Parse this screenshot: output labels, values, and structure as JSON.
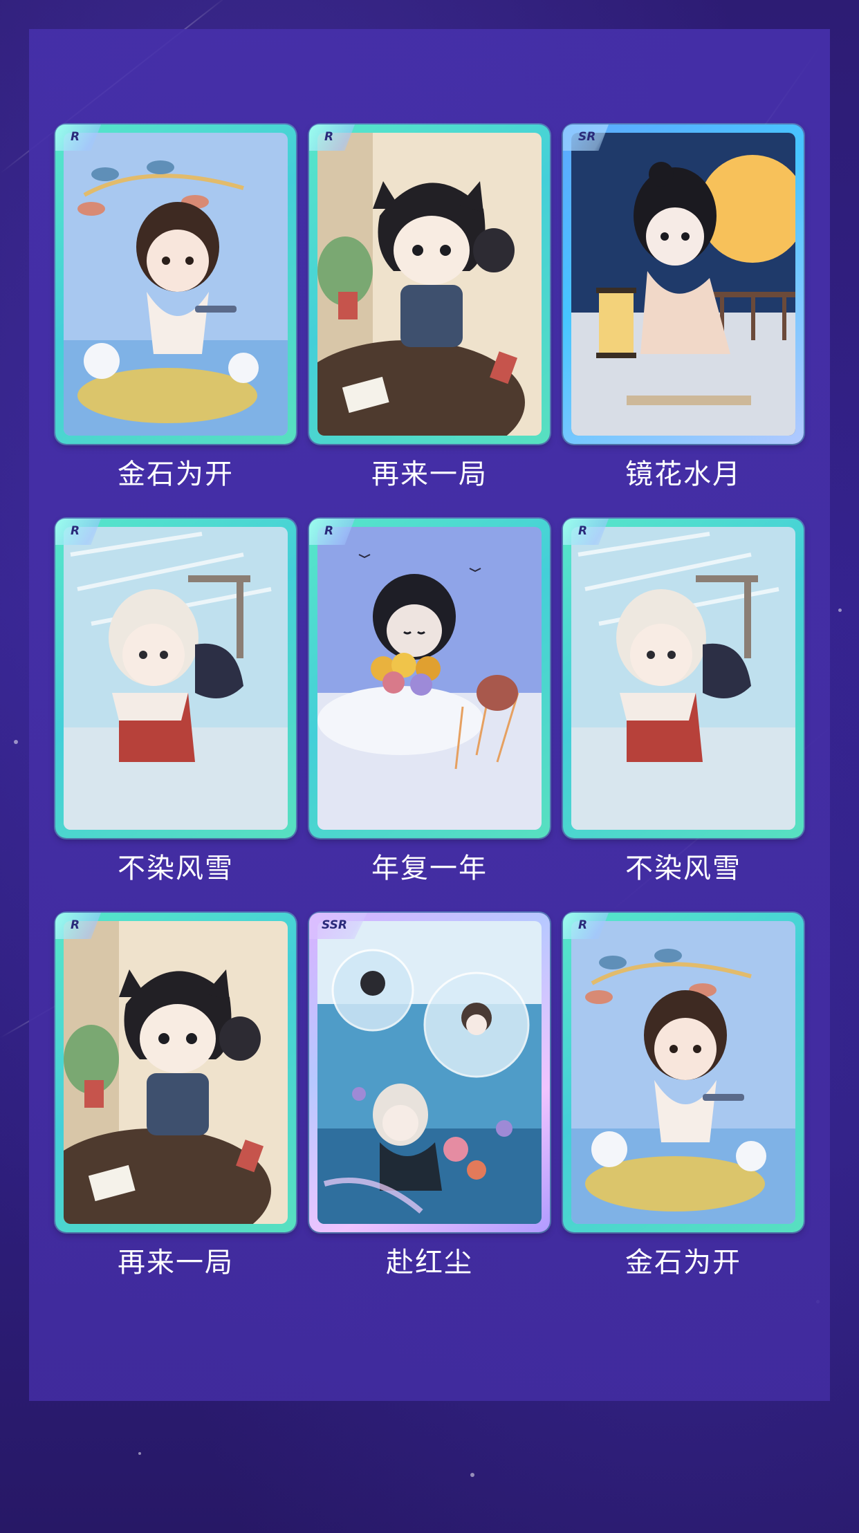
{
  "cards": [
    {
      "rarity": "R",
      "title": "金石为开",
      "art": "chibi-with-pipe-icon"
    },
    {
      "rarity": "R",
      "title": "再来一局",
      "art": "chibi-cards-icon"
    },
    {
      "rarity": "SR",
      "title": "镜花水月",
      "art": "chibi-moon-lantern-icon"
    },
    {
      "rarity": "R",
      "title": "不染风雪",
      "art": "chibi-snow-icon"
    },
    {
      "rarity": "R",
      "title": "年复一年",
      "art": "chibi-flowers-icon"
    },
    {
      "rarity": "R",
      "title": "不染风雪",
      "art": "chibi-snow-icon"
    },
    {
      "rarity": "R",
      "title": "再来一局",
      "art": "chibi-cards-icon"
    },
    {
      "rarity": "SSR",
      "title": "赴红尘",
      "art": "chibi-bubbles-icon"
    },
    {
      "rarity": "R",
      "title": "金石为开",
      "art": "chibi-with-pipe-icon"
    }
  ],
  "colors": {
    "background": "#2d1c74",
    "panel": "#4630aa",
    "frame_r": "#58e6c8",
    "frame_sr": "#5fa8ff",
    "frame_ssr": "#d9b2ff",
    "label_text": "#ffffff"
  }
}
